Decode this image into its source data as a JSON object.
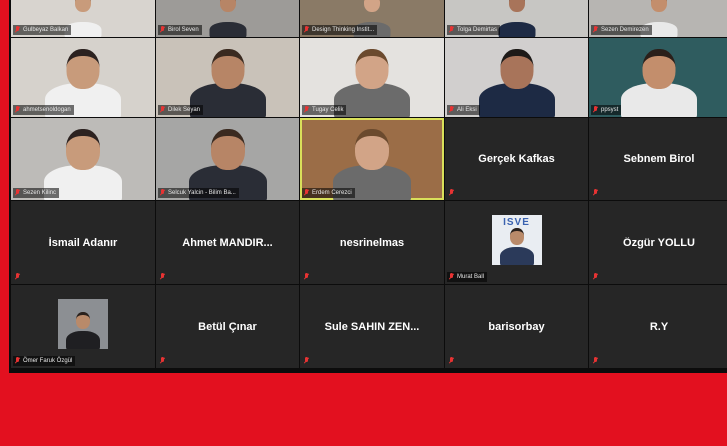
{
  "meeting": {
    "participants": [
      {
        "label": "Gulbeyaz Balkan",
        "display": "video",
        "bg": "#d8d4cf"
      },
      {
        "label": "Birol Seven",
        "display": "video",
        "bg": "#9d9b98"
      },
      {
        "label": "Design Thinking Instit...",
        "display": "video",
        "bg": "#8a7a66"
      },
      {
        "label": "Tolga Demirtas",
        "display": "video",
        "bg": "#c7c6c3"
      },
      {
        "label": "Sezen Demirezen",
        "display": "video",
        "bg": "#b7b5b2"
      },
      {
        "label": "ahmetsenoldogan",
        "display": "video",
        "bg": "#d6d2cc"
      },
      {
        "label": "Dilek Seyan",
        "display": "video",
        "bg": "#c9c2b9"
      },
      {
        "label": "Tugay Celik",
        "display": "video",
        "bg": "#e4e2df"
      },
      {
        "label": "Ali Eksi",
        "display": "video",
        "bg": "#d1cfce"
      },
      {
        "label": "ppsyst",
        "display": "video",
        "bg": "#2f5c5f"
      },
      {
        "label": "Sezen Kilinc",
        "display": "video",
        "bg": "#bdbbb8"
      },
      {
        "label": "Selcuk Yalcin - Bilim Ba...",
        "display": "video",
        "bg": "#a6a6a5"
      },
      {
        "label": "Erdem Cerezci",
        "display": "video",
        "bg": "#9b6d47",
        "active": true
      },
      {
        "name": "Gerçek Kafkas",
        "display": "name"
      },
      {
        "name": "Sebnem Birol",
        "display": "name"
      },
      {
        "name": "İsmail Adanır",
        "display": "name"
      },
      {
        "name": "Ahmet  MANDIR...",
        "display": "name"
      },
      {
        "name": "nesrinelmas",
        "display": "name"
      },
      {
        "label": "Murat Ball",
        "display": "thumb",
        "thumb_text": "ISVE"
      },
      {
        "name": "Özgür YOLLU",
        "display": "name"
      },
      {
        "label": "Ömer Faruk Özgül",
        "display": "thumb"
      },
      {
        "name": "Betül Çınar",
        "display": "name"
      },
      {
        "name": "Sule SAHIN ZEN...",
        "display": "name"
      },
      {
        "name": "barisorbay",
        "display": "name"
      },
      {
        "name": "R.Y",
        "display": "name"
      }
    ]
  }
}
